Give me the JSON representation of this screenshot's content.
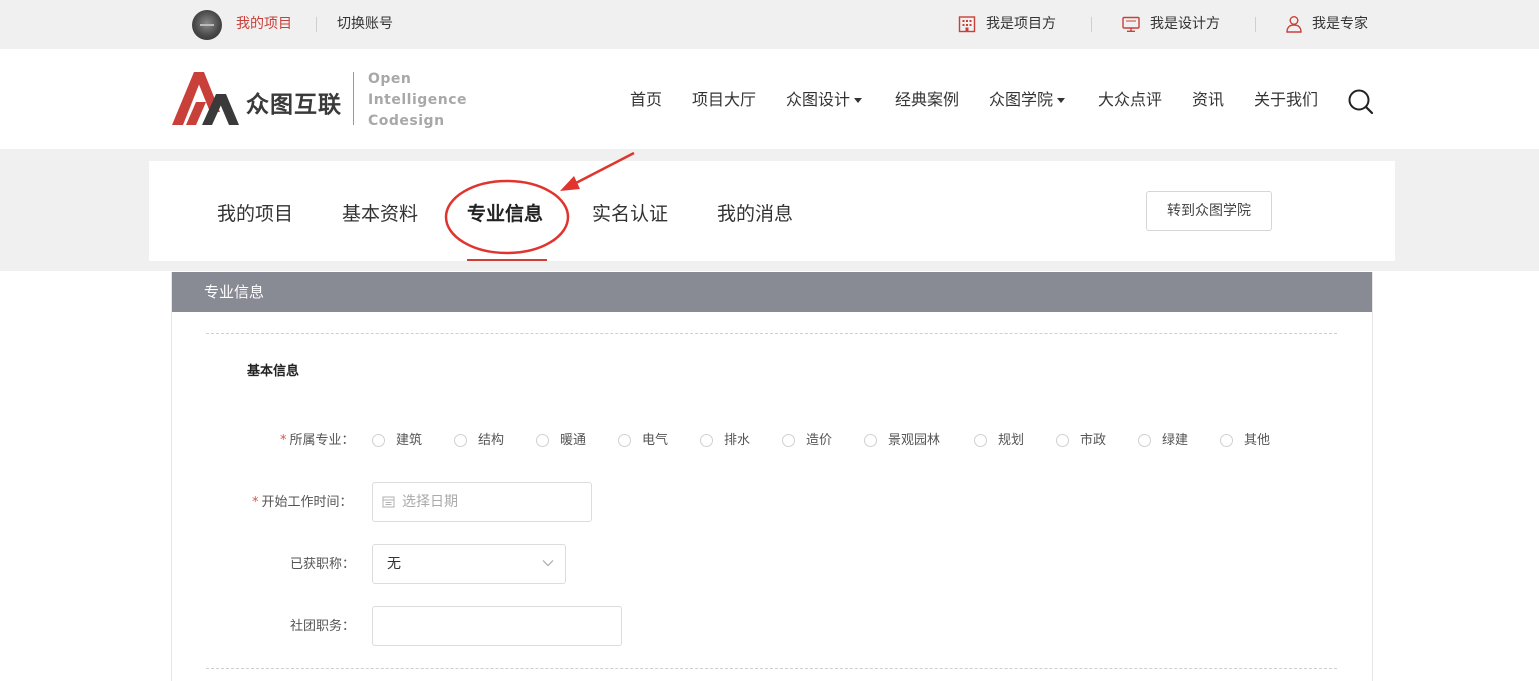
{
  "topbar": {
    "my_projects": "我的项目",
    "switch_account": "切换账号",
    "project_owner": "我是项目方",
    "designer": "我是设计方",
    "expert": "我是专家"
  },
  "header": {
    "logo_text": "众图互联",
    "logo_en_1": "Open",
    "logo_en_2": "Intelligence",
    "logo_en_3": "Codesign",
    "nav": [
      "首页",
      "项目大厅",
      "众图设计",
      "经典案例",
      "众图学院",
      "大众点评",
      "资讯",
      "关于我们"
    ]
  },
  "tabs": {
    "items": [
      "我的项目",
      "基本资料",
      "专业信息",
      "实名认证",
      "我的消息"
    ],
    "active": "专业信息",
    "go_academy": "转到众图学院"
  },
  "card": {
    "title": "专业信息",
    "section_title": "基本信息"
  },
  "form": {
    "major_label": "所属专业：",
    "majors": [
      "建筑",
      "结构",
      "暖通",
      "电气",
      "排水",
      "造价",
      "景观园林",
      "规划",
      "市政",
      "绿建",
      "其他"
    ],
    "start_label": "开始工作时间：",
    "start_placeholder": "选择日期",
    "title_label": "已获职称：",
    "title_value": "无",
    "society_label": "社团职务：",
    "society_value": ""
  },
  "colors": {
    "accent": "#c9403a",
    "card_header": "#888a94",
    "band": "#f0f0f0"
  },
  "icons": {
    "project_owner": "building-icon",
    "designer": "monitor-icon",
    "expert": "person-icon",
    "search": "search-icon",
    "date": "calendar-icon",
    "select": "chevron-down-icon"
  }
}
